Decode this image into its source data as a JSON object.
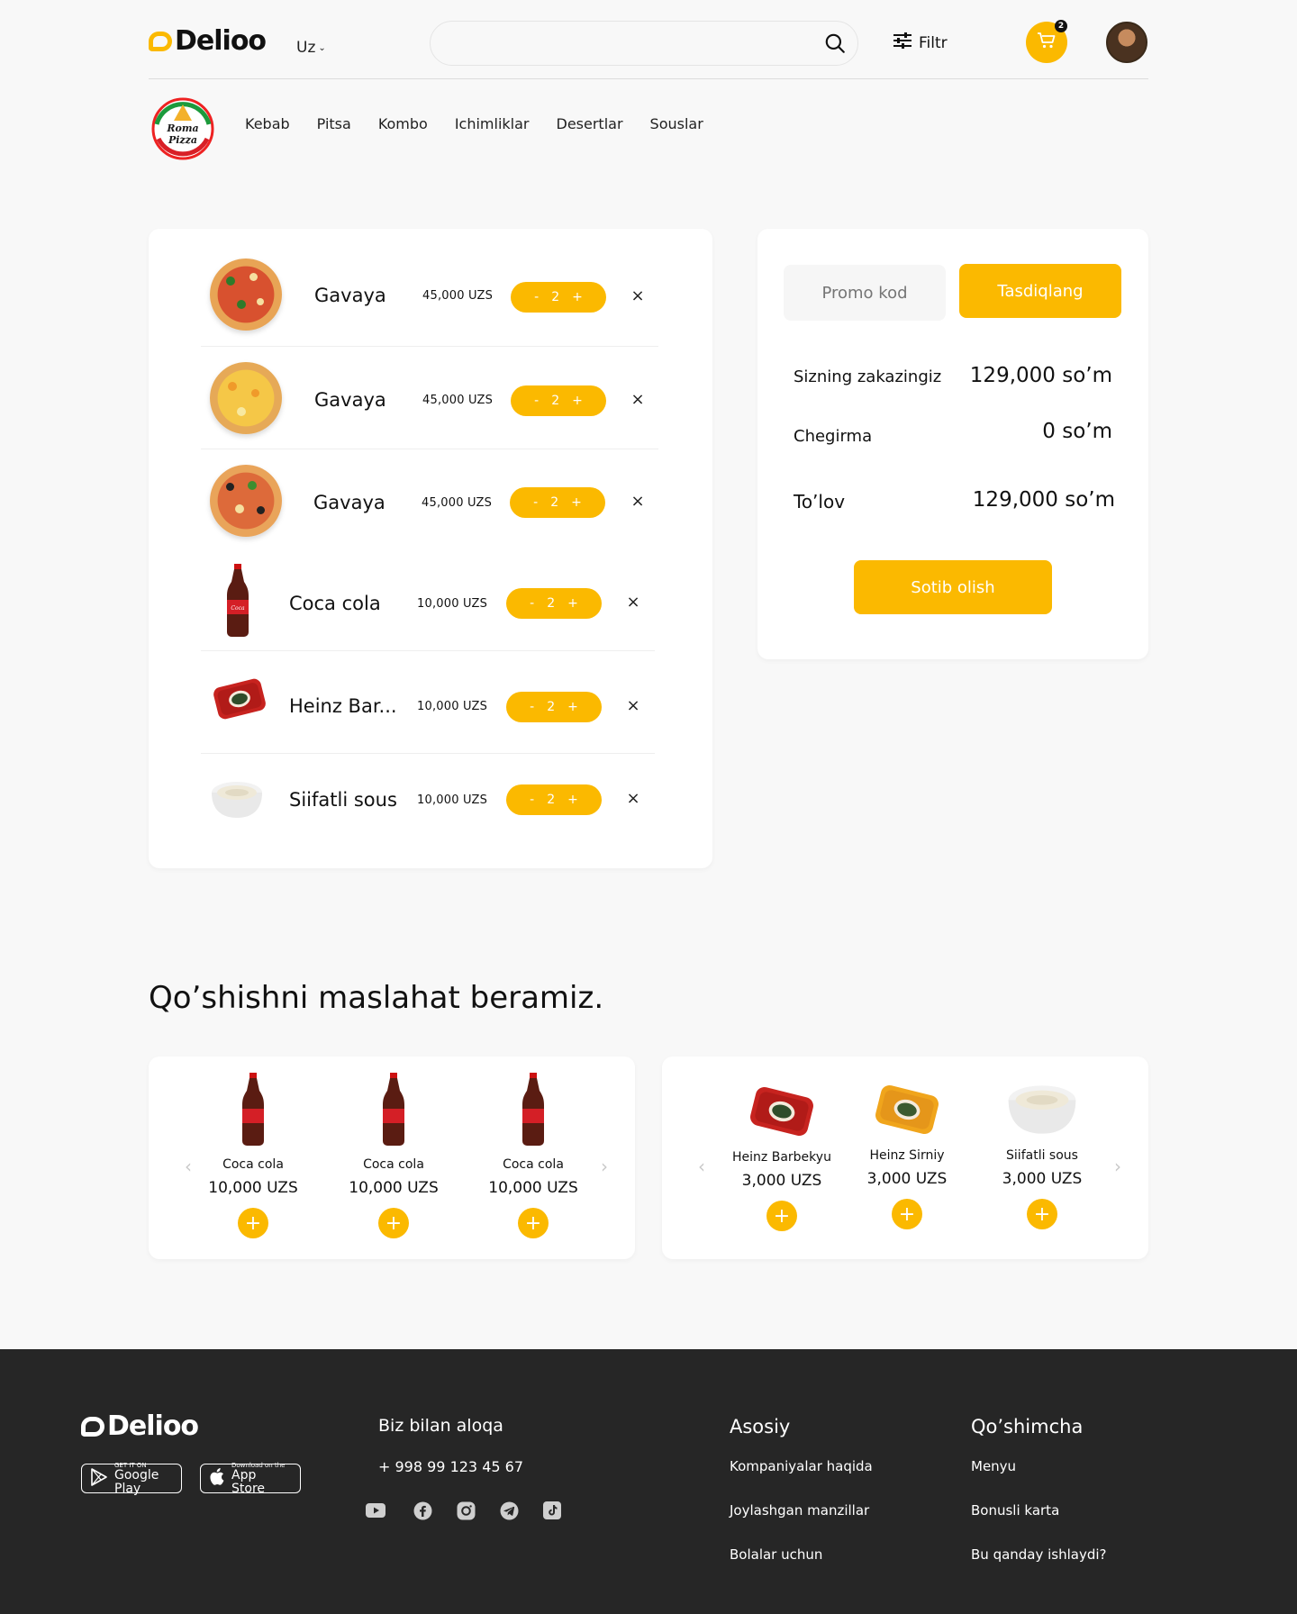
{
  "header": {
    "logo": "Delioo",
    "language": "Uz",
    "search_placeholder": "",
    "filter_label": "Filtr",
    "cart_count": "2"
  },
  "restaurant": {
    "logo_text": "Roma Pizza",
    "nav": [
      "Kebab",
      "Pitsa",
      "Kombo",
      "Ichimliklar",
      "Desertlar",
      "Souslar"
    ]
  },
  "cart_items": [
    {
      "name": "Gavaya",
      "price": "45,000 UZS",
      "qty": "2",
      "kind": "pizza-red"
    },
    {
      "name": "Gavaya",
      "price": "45,000 UZS",
      "qty": "2",
      "kind": "pizza-yellow"
    },
    {
      "name": "Gavaya",
      "price": "45,000 UZS",
      "qty": "2",
      "kind": "pizza-veg"
    },
    {
      "name": "Coca cola",
      "price": "10,000 UZS",
      "qty": "2",
      "kind": "cola"
    },
    {
      "name": "Heinz Bar...",
      "price": "10,000 UZS",
      "qty": "2",
      "kind": "heinz"
    },
    {
      "name": "Siifatli sous",
      "price": "10,000 UZS",
      "qty": "2",
      "kind": "sauce"
    }
  ],
  "qty_minus": "-",
  "qty_plus": "+",
  "remove_symbol": "×",
  "summary": {
    "promo_placeholder": "Promo kod",
    "confirm_label": "Tasdiqlang",
    "order_label": "Sizning zakazingiz",
    "order_value": "129,000 so’m",
    "discount_label": "Chegirma",
    "discount_value": "0 so’m",
    "payment_label": "To’lov",
    "payment_value": "129,000 so’m",
    "buy_label": "Sotib olish"
  },
  "suggestions": {
    "title": "Qo’shishni maslahat beramiz.",
    "left": [
      {
        "name": "Coca cola",
        "price": "10,000 UZS"
      },
      {
        "name": "Coca cola",
        "price": "10,000 UZS"
      },
      {
        "name": "Coca cola",
        "price": "10,000 UZS"
      }
    ],
    "right": [
      {
        "name": "Heinz Barbekyu",
        "price": "3,000 UZS",
        "kind": "heinz"
      },
      {
        "name": "Heinz Sirniy",
        "price": "3,000 UZS",
        "kind": "heinz-yellow"
      },
      {
        "name": "Siifatli sous",
        "price": "3,000 UZS",
        "kind": "sauce"
      }
    ],
    "add_symbol": "+"
  },
  "footer": {
    "logo": "Delioo",
    "google_small": "GET IT ON",
    "google_big": "Google Play",
    "apple_small": "Download on the",
    "apple_big": "App Store",
    "contact_title": "Biz bilan aloqa",
    "phone": "+ 998 99 123 45 67",
    "main_title": "Asosiy",
    "main_links": [
      "Kompaniyalar haqida",
      "Joylashgan manzillar",
      "Bolalar uchun"
    ],
    "extra_title": "Qo’shimcha",
    "extra_links": [
      "Menyu",
      "Bonusli karta",
      "Bu qanday ishlaydi?"
    ],
    "social_icons": [
      "youtube-icon",
      "facebook-icon",
      "instagram-icon",
      "telegram-icon",
      "tiktok-icon"
    ]
  },
  "colors": {
    "accent": "#FBB900",
    "footer_bg": "#262626",
    "page_bg": "#F8F8F8"
  }
}
